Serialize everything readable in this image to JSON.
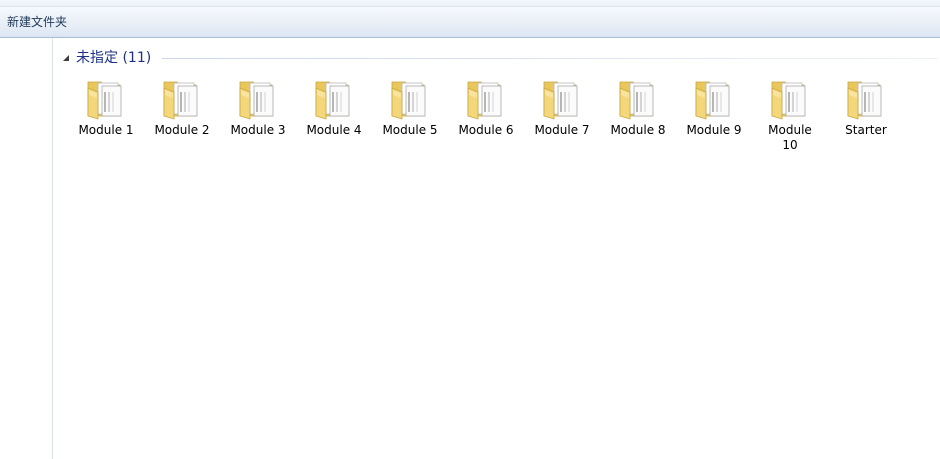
{
  "toolbar": {
    "new_folder_label": "新建文件夹"
  },
  "group": {
    "title": "未指定 (11)"
  },
  "items": [
    {
      "label": "Module 1",
      "icon": "folder-icon"
    },
    {
      "label": "Module 2",
      "icon": "folder-icon"
    },
    {
      "label": "Module 3",
      "icon": "folder-icon"
    },
    {
      "label": "Module 4",
      "icon": "folder-icon"
    },
    {
      "label": "Module 5",
      "icon": "folder-icon"
    },
    {
      "label": "Module 6",
      "icon": "folder-icon"
    },
    {
      "label": "Module 7",
      "icon": "folder-icon"
    },
    {
      "label": "Module 8",
      "icon": "folder-icon"
    },
    {
      "label": "Module 9",
      "icon": "folder-icon"
    },
    {
      "label": "Module 10",
      "icon": "folder-icon"
    },
    {
      "label": "Starter",
      "icon": "folder-icon"
    }
  ],
  "colors": {
    "group_title": "#1e3287",
    "toolbar_text": "#1e395b",
    "folder_body": "#f3d77a",
    "folder_edge": "#c9a640"
  }
}
